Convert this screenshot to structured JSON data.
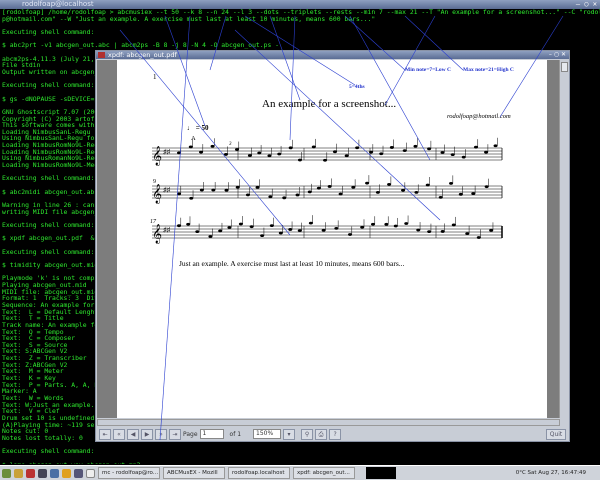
{
  "terminal": {
    "title": "rodolfoap@localhost",
    "lines": [
      "[rodolfoap] /home/rodolfoap > abcmusiex --t 50 --k 8 --n 24 --l 3 --dots --triplets --rests --min 7 --max 21 --T \"An example for a screenshot...\" --C \"rodolfoa",
      "p@hotmail.com\" --W \"Just an example. A exercise must last at least 10 minutes, means 600 bars...\"",
      "",
      "Executing shell command:",
      "",
      "$ abc2prt -v1 abcgen_out.abc | abcm2ps -B 8 -j 8 -N 4 -O abcgen_out.ps -",
      "",
      "abcm2ps-4.11.3 (July 21,",
      "File stdin",
      "Output written on abcgen_",
      "",
      "Executing shell command:",
      "",
      "$ gs -dNOPAUSE -sDEVICE=p",
      "",
      "GNU Ghostscript 7.07 (200",
      "Copyright (C) 2003 artofc",
      "This software comes with",
      "Loading NimbusSanL-Regu f",
      "Using NimbusSanL-Regu fo",
      "Loading NimbusRomNo9L-Reg",
      "Loading NimbusRomNo9L-Reg",
      "Using NimbusRomanNo9L-Reg",
      "Loading NimbusRomNo9L-Med",
      "",
      "Executing shell command:",
      "",
      "$ abc2midi abcgen_out.abc",
      "",
      "Warning in line 26 : cann",
      "writing MIDI file abcgen_",
      "",
      "Executing shell command:",
      "",
      "$ xpdf abcgen_out.pdf  &",
      "",
      "Executing shell command:",
      "",
      "$ timidity abcgen_out.mid",
      "",
      "Playmode 'k' is not compi",
      "Playing abcgen_out.mid",
      "MIDI file: abcgen_out.mid",
      "Format: 1  Tracks: 3  Div",
      "Sequence: An example for",
      "Text:  L = Default Lenght",
      "Text:  T = Title",
      "Track name: An example fo",
      "Text:  Q = Tempo",
      "Text:  C = Composer",
      "Text:  S = Source",
      "Text: S:ABCGen V2",
      "Text:  Z = Transcriber",
      "Text: Z:ABCGen V2",
      "Text:  M = Meter",
      "Text:  K = Key",
      "Text:  P = Parts. A, A, B",
      "Marker: A",
      "Text:  W = Words",
      "Text: W:Just an example.",
      "Text:  V = Clef",
      "Drum set 10 is undefined",
      "(A)Playing time: ~119 sec",
      "Notes cut: 0",
      "Notes lost totally: 0",
      "",
      "Executing shell command:",
      "",
      "$ lame abcgen_out.wav abcgen_out.mp3"
    ]
  },
  "xpdf": {
    "title": "xpdf: abcgen_out.pdf",
    "page": {
      "number": "1",
      "title": "An example for a screenshot...",
      "composer": "rodolfoap@hotmail.com",
      "tempo": "♩ = 50",
      "part": "A",
      "bar9": "9",
      "bar17": "17",
      "words": "Just an example. A exercise must last at least 10 minutes, means 600 bars...",
      "triplet": "3"
    },
    "annotations": {
      "fourths": "5=4ths",
      "min": "Min note=7=Low C",
      "max": "Max note=21=High C"
    },
    "toolbar": {
      "page_label": "Page",
      "page_value": "1",
      "of_label": "of 1",
      "zoom": "150%",
      "quit": "Quit"
    }
  },
  "taskbar": {
    "tasks": [
      "mc - rodolfoap@ro...",
      "ABCMusEX - Mozill",
      "rodolfoap.localhost",
      "xpdf: abcgen_out..."
    ],
    "clock": "0°C  Sat Aug 27, 16:47:49"
  }
}
